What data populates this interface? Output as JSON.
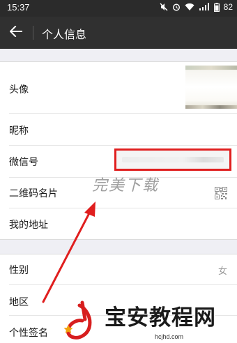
{
  "status_bar": {
    "time": "15:37",
    "battery": "82"
  },
  "app_bar": {
    "title": "个人信息"
  },
  "profile_group": {
    "rows": [
      {
        "label": "头像"
      },
      {
        "label": "昵称"
      },
      {
        "label": "微信号"
      },
      {
        "label": "二维码名片"
      },
      {
        "label": "我的地址"
      }
    ]
  },
  "detail_group": {
    "rows": [
      {
        "label": "性别",
        "value": "女"
      },
      {
        "label": "地区"
      },
      {
        "label": "个性签名"
      }
    ]
  },
  "overlay": {
    "watermark": "完美下载",
    "brand_name": "宝安教程网",
    "brand_url": "hcjhd.com",
    "annotation_color": "#e01e1e"
  }
}
